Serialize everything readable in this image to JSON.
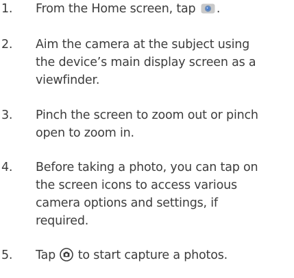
{
  "steps": [
    {
      "num": "1.",
      "before": "From the Home screen, tap ",
      "after": ".",
      "icon": "camera-app-icon"
    },
    {
      "num": "2.",
      "lines": [
        "Aim the camera at the subject using",
        "the device’s main display screen as a",
        "viewfinder."
      ]
    },
    {
      "num": "3.",
      "lines": [
        "Pinch the screen to zoom out or pinch",
        "open to zoom in."
      ]
    },
    {
      "num": "4.",
      "lines": [
        "Before taking a photo, you can tap on",
        "the screen icons to access various",
        "camera options and settings, if",
        "required."
      ]
    },
    {
      "num": "5.",
      "before": "Tap ",
      "after": " to start capture a photos.",
      "icon": "shutter-button-icon"
    }
  ],
  "colors": {
    "text": "#3c3c3c",
    "icon_blue": "#5a8fd8",
    "icon_gray": "#c9c9c9"
  }
}
